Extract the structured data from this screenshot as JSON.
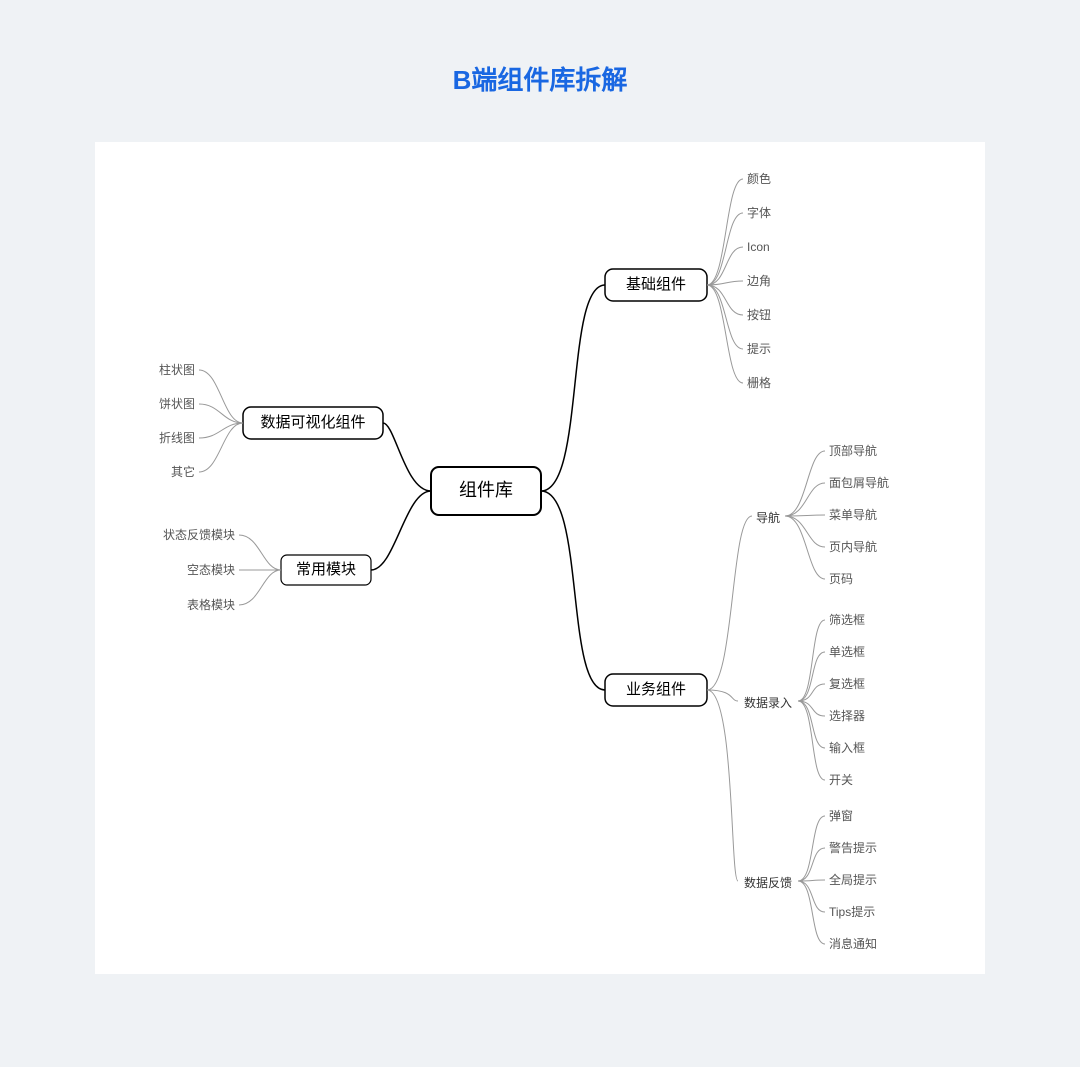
{
  "page_title": "B端组件库拆解",
  "root": "组件库",
  "left": {
    "dataviz": {
      "label": "数据可视化组件",
      "children": [
        "柱状图",
        "饼状图",
        "折线图",
        "其它"
      ]
    },
    "modules": {
      "label": "常用模块",
      "children": [
        "状态反馈模块",
        "空态模块",
        "表格模块"
      ]
    }
  },
  "right": {
    "basic": {
      "label": "基础组件",
      "children": [
        "颜色",
        "字体",
        "Icon",
        "边角",
        "按钮",
        "提示",
        "栅格"
      ]
    },
    "business": {
      "label": "业务组件",
      "groups": {
        "nav": {
          "label": "导航",
          "children": [
            "顶部导航",
            "面包屑导航",
            "菜单导航",
            "页内导航",
            "页码"
          ]
        },
        "input": {
          "label": "数据录入",
          "children": [
            "筛选框",
            "单选框",
            "复选框",
            "选择器",
            "输入框",
            "开关"
          ]
        },
        "feedback": {
          "label": "数据反馈",
          "children": [
            "弹窗",
            "警告提示",
            "全局提示",
            "Tips提示",
            "消息通知"
          ]
        }
      }
    }
  }
}
